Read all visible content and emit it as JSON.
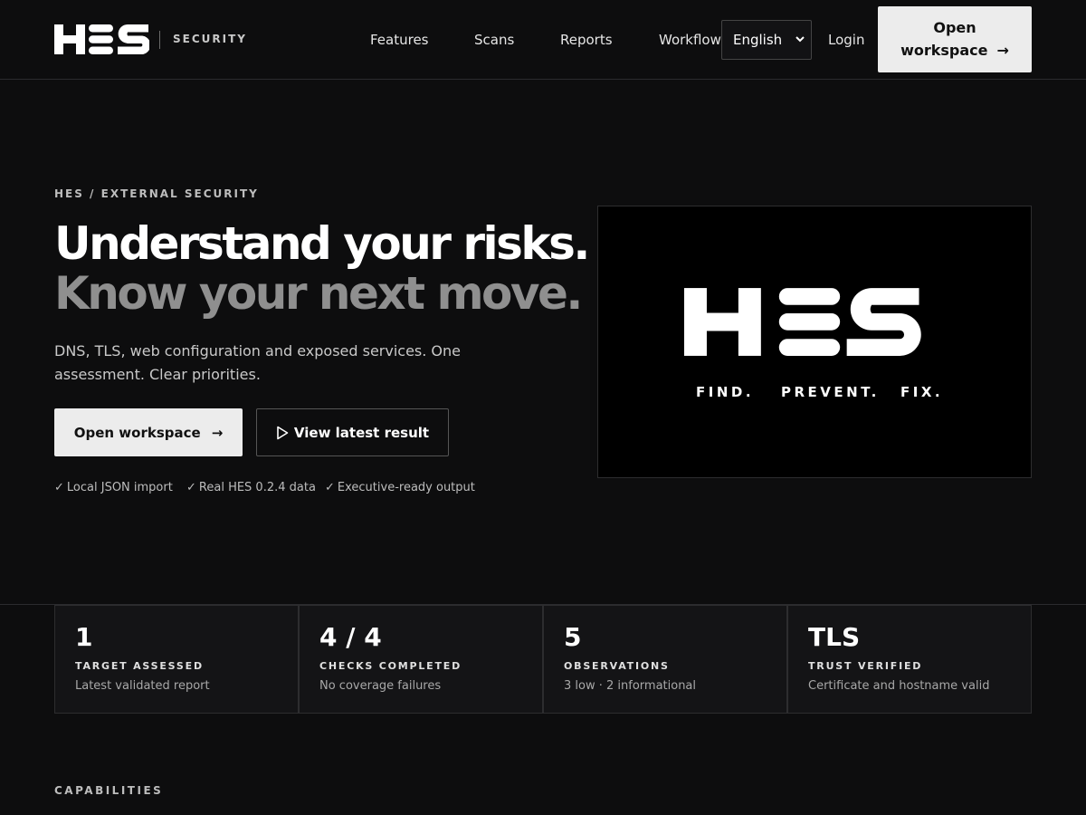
{
  "header": {
    "logo_text": "HES",
    "brand_sub": "SECURITY",
    "nav": [
      "Features",
      "Scans",
      "Reports",
      "Workflow"
    ],
    "language": "English",
    "login": "Login",
    "cta_line1": "Open",
    "cta_line2": "workspace",
    "arrow": "→"
  },
  "hero": {
    "eyebrow": "HES / EXTERNAL SECURITY",
    "headline_1": "Understand your risks.",
    "headline_2": "Know your next move.",
    "lead": "DNS, TLS, web configuration and exposed services. One assessment. Clear priorities.",
    "primary_button": "Open workspace",
    "secondary_button": "View latest result",
    "checks": [
      "Local JSON import",
      "Real HES 0.2.4 data",
      "Executive-ready output"
    ],
    "check_mark": "✓",
    "panel_logo": "HES",
    "tagline": [
      "FIND.",
      "PREVENT.",
      "FIX."
    ]
  },
  "stats": [
    {
      "value": "1",
      "label": "TARGET ASSESSED",
      "sub": "Latest validated report"
    },
    {
      "value": "4 / 4",
      "label": "CHECKS COMPLETED",
      "sub": "No coverage failures"
    },
    {
      "value": "5",
      "label": "OBSERVATIONS",
      "sub": "3 low · 2 informational"
    },
    {
      "value": "TLS",
      "label": "TRUST VERIFIED",
      "sub": "Certificate and hostname valid"
    }
  ],
  "section_label": "CAPABILITIES",
  "colors": {
    "background": "#0d0d0e",
    "accent": "#ececec",
    "muted_headline": "#8f8f8f"
  }
}
